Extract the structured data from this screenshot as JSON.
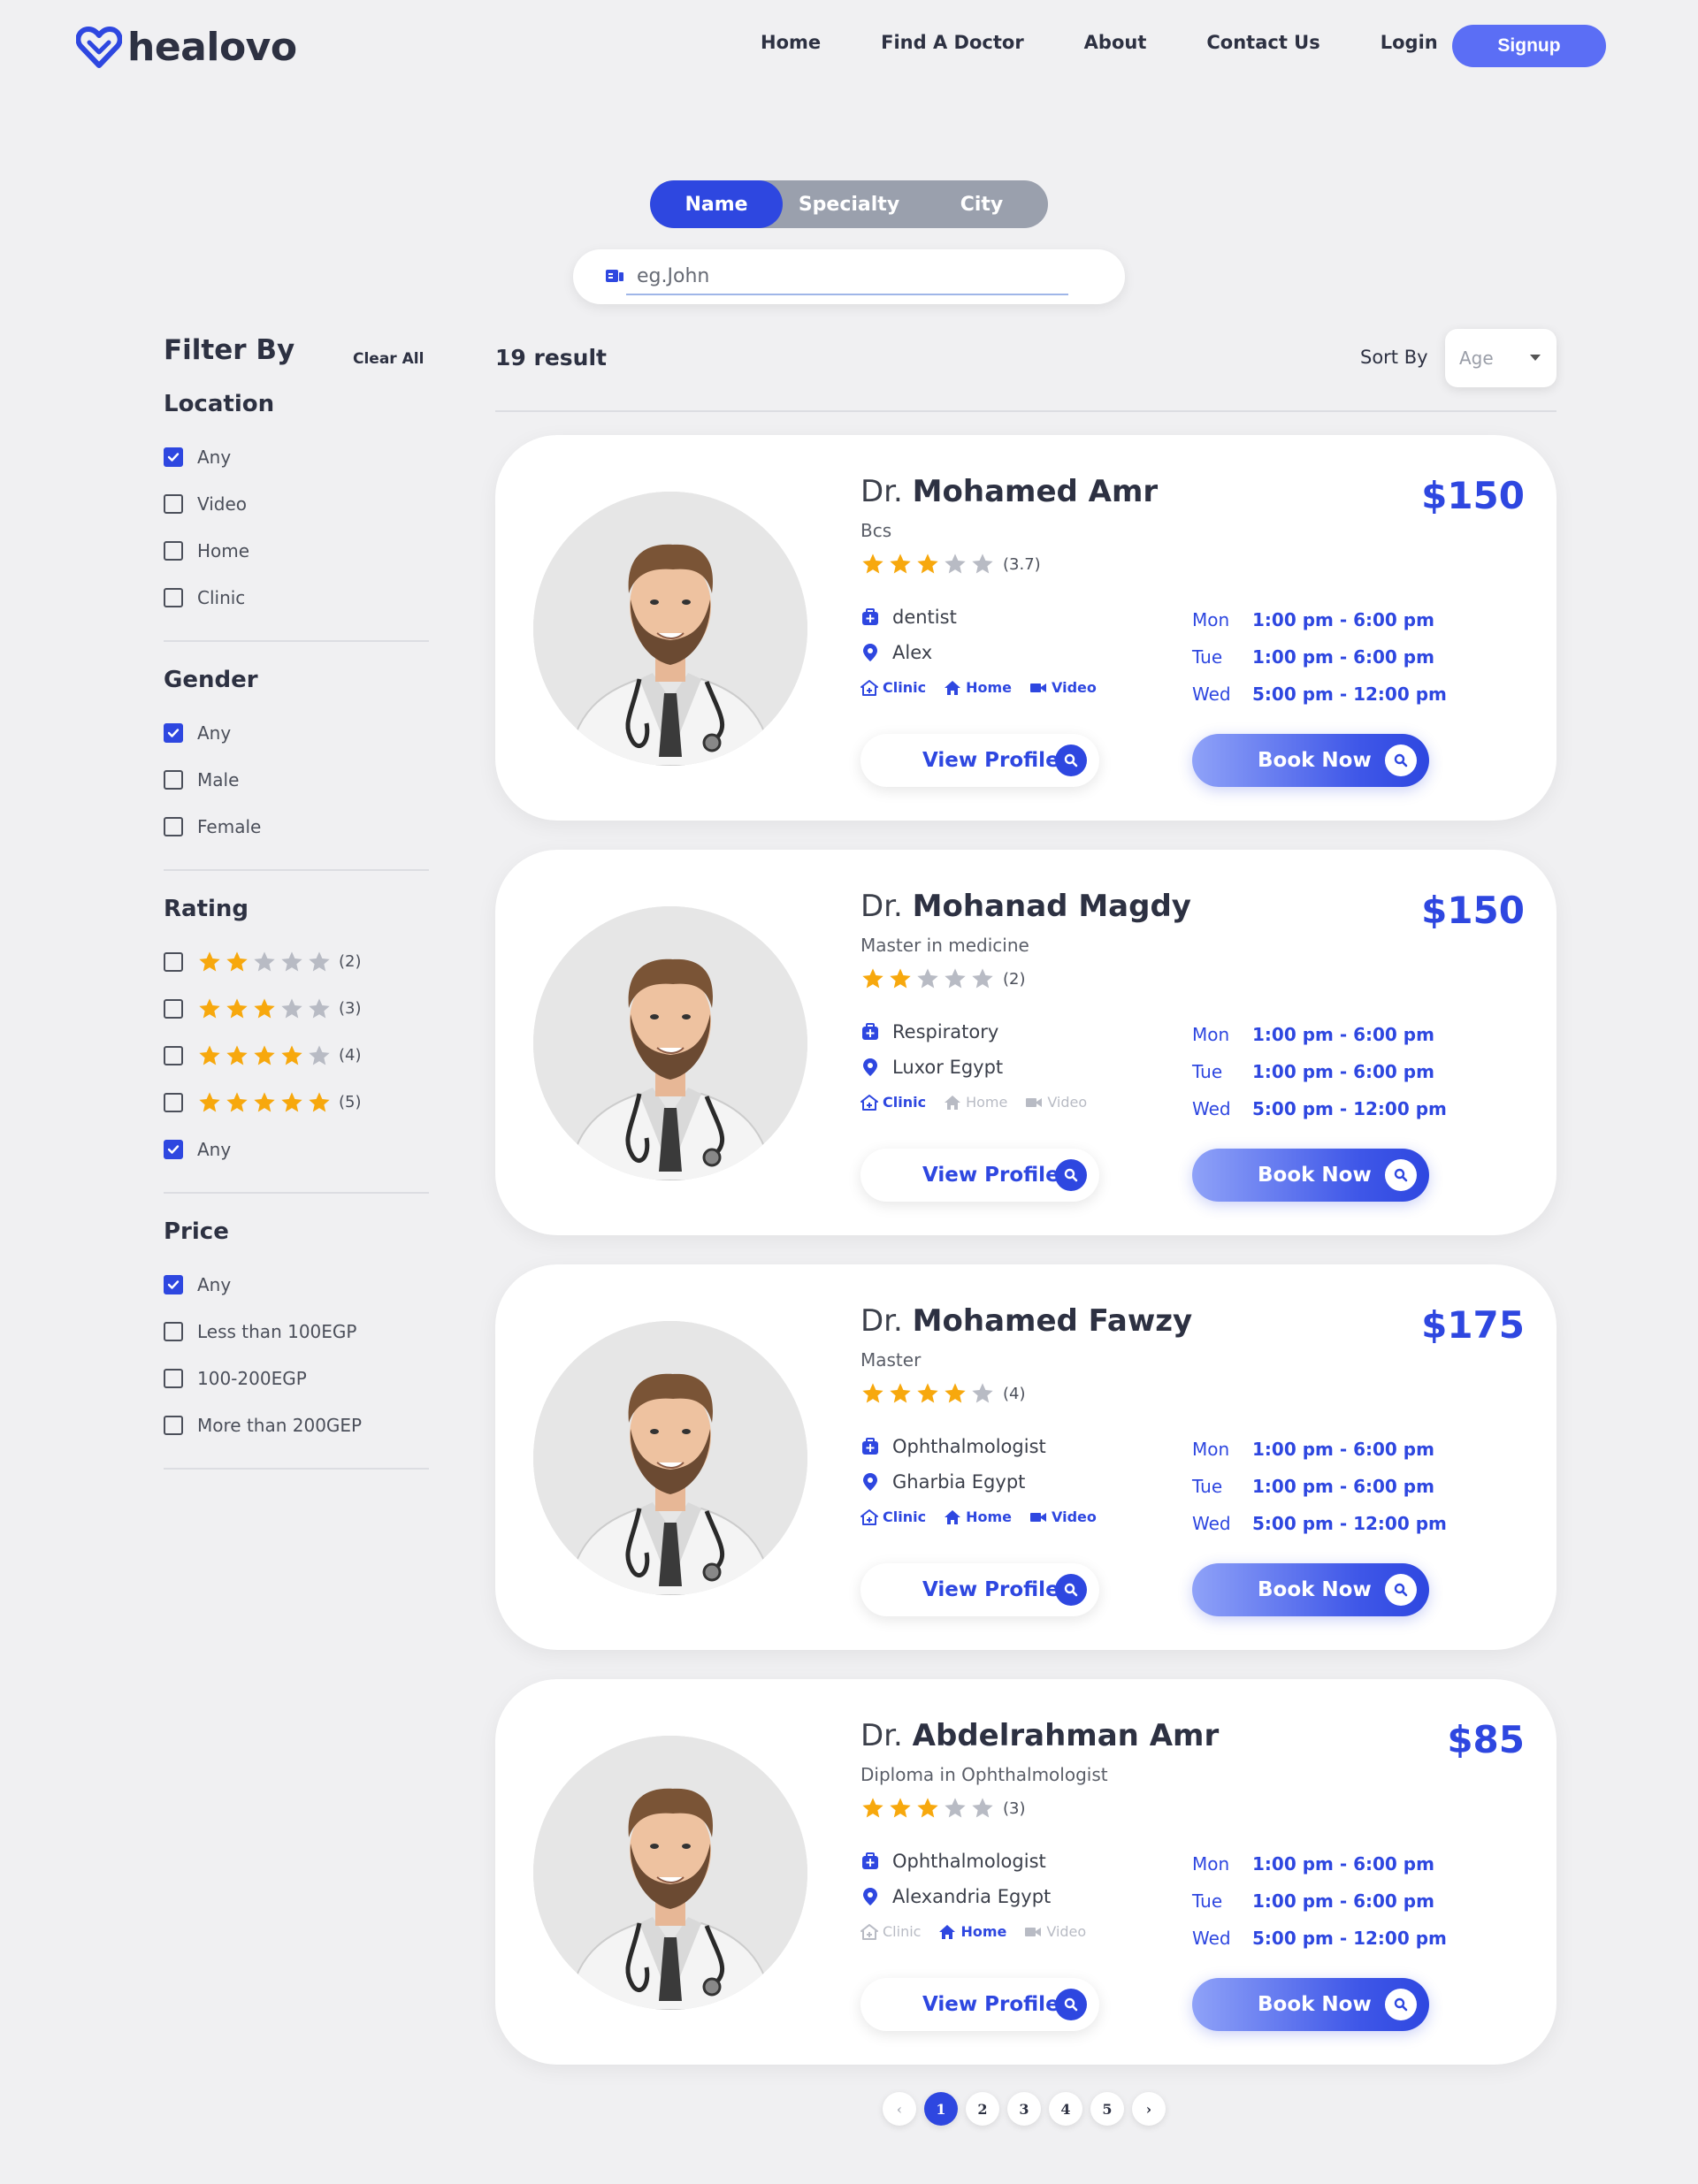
{
  "brand": {
    "name": "healovo",
    "accent": "#2e47e0"
  },
  "nav": {
    "links": [
      "Home",
      "Find A Doctor",
      "About",
      "Contact Us",
      "Login"
    ],
    "signup": "Signup"
  },
  "search": {
    "tabs": [
      "Name",
      "Specialty",
      "City"
    ],
    "active_tab": "Name",
    "placeholder": "eg.John"
  },
  "filters": {
    "title": "Filter By",
    "clear_all": "Clear All",
    "location": {
      "title": "Location",
      "options": [
        {
          "label": "Any",
          "checked": true
        },
        {
          "label": "Video",
          "checked": false
        },
        {
          "label": "Home",
          "checked": false
        },
        {
          "label": "Clinic",
          "checked": false
        }
      ]
    },
    "gender": {
      "title": "Gender",
      "options": [
        {
          "label": "Any",
          "checked": true
        },
        {
          "label": "Male",
          "checked": false
        },
        {
          "label": "Female",
          "checked": false
        }
      ]
    },
    "rating": {
      "title": "Rating",
      "options": [
        {
          "stars": 2,
          "label": "(2)",
          "checked": false
        },
        {
          "stars": 3,
          "label": "(3)",
          "checked": false
        },
        {
          "stars": 4,
          "label": "(4)",
          "checked": false
        },
        {
          "stars": 5,
          "label": "(5)",
          "checked": false
        },
        {
          "label": "Any",
          "checked": true
        }
      ]
    },
    "price": {
      "title": "Price",
      "options": [
        {
          "label": "Any",
          "checked": true
        },
        {
          "label": "Less than 100EGP",
          "checked": false
        },
        {
          "label": "100-200EGP",
          "checked": false
        },
        {
          "label": "More than 200GEP",
          "checked": false
        }
      ]
    }
  },
  "results": {
    "count": "19 result",
    "sort_label": "Sort By",
    "sort_value": "Age"
  },
  "doctors": [
    {
      "prefix": "Dr.",
      "name": "Mohamed Amr",
      "price": "$150",
      "degree": "Bcs",
      "stars": 3,
      "rating": "(3.7)",
      "specialty": "dentist",
      "city": "Alex",
      "services": {
        "clinic": true,
        "home": true,
        "video": true
      },
      "schedule": [
        {
          "day": "Mon",
          "time": "1:00 pm - 6:00 pm"
        },
        {
          "day": "Tue",
          "time": "1:00 pm - 6:00 pm"
        },
        {
          "day": "Wed",
          "time": "5:00 pm - 12:00 pm"
        }
      ]
    },
    {
      "prefix": "Dr.",
      "name": "Mohanad Magdy",
      "price": "$150",
      "degree": "Master in medicine",
      "stars": 2,
      "rating": "(2)",
      "specialty": "Respiratory",
      "city": "Luxor Egypt",
      "services": {
        "clinic": true,
        "home": false,
        "video": false
      },
      "schedule": [
        {
          "day": "Mon",
          "time": "1:00 pm - 6:00 pm"
        },
        {
          "day": "Tue",
          "time": "1:00 pm - 6:00 pm"
        },
        {
          "day": "Wed",
          "time": "5:00 pm - 12:00 pm"
        }
      ]
    },
    {
      "prefix": "Dr.",
      "name": "Mohamed Fawzy",
      "price": "$175",
      "degree": "Master",
      "stars": 4,
      "rating": "(4)",
      "specialty": "Ophthalmologist",
      "city": "Gharbia Egypt",
      "services": {
        "clinic": true,
        "home": true,
        "video": true
      },
      "schedule": [
        {
          "day": "Mon",
          "time": "1:00 pm - 6:00 pm"
        },
        {
          "day": "Tue",
          "time": "1:00 pm - 6:00 pm"
        },
        {
          "day": "Wed",
          "time": "5:00 pm - 12:00 pm"
        }
      ]
    },
    {
      "prefix": "Dr.",
      "name": "Abdelrahman Amr",
      "price": "$85",
      "degree": "Diploma in Ophthalmologist",
      "stars": 3,
      "rating": "(3)",
      "specialty": "Ophthalmologist",
      "city": "Alexandria Egypt",
      "services": {
        "clinic": false,
        "home": true,
        "video": false
      },
      "schedule": [
        {
          "day": "Mon",
          "time": "1:00 pm - 6:00 pm"
        },
        {
          "day": "Tue",
          "time": "1:00 pm - 6:00 pm"
        },
        {
          "day": "Wed",
          "time": "5:00 pm - 12:00 pm"
        }
      ]
    }
  ],
  "card_labels": {
    "clinic": "Clinic",
    "home": "Home",
    "video": "Video",
    "view_profile": "View Profile",
    "book_now": "Book Now"
  },
  "pagination": {
    "pages": [
      "1",
      "2",
      "3",
      "4",
      "5"
    ],
    "current": "1"
  }
}
